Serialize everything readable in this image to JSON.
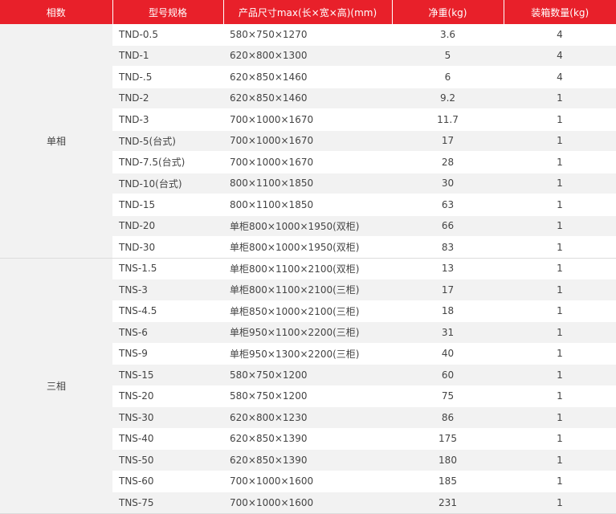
{
  "headers": [
    "相数",
    "型号规格",
    "产品尺寸max(长×宽×高)(mm)",
    "净重(kg)",
    "装箱数量(kg)"
  ],
  "groups": [
    {
      "phase": "单相",
      "rows": [
        {
          "model": "TND-0.5",
          "dims": "580×750×1270",
          "weight": "3.6",
          "qty": "4"
        },
        {
          "model": "TND-1",
          "dims": "620×800×1300",
          "weight": "5",
          "qty": "4"
        },
        {
          "model": "TND-.5",
          "dims": "620×850×1460",
          "weight": "6",
          "qty": "4"
        },
        {
          "model": "TND-2",
          "dims": "620×850×1460",
          "weight": "9.2",
          "qty": "1"
        },
        {
          "model": "TND-3",
          "dims": "700×1000×1670",
          "weight": "11.7",
          "qty": "1"
        },
        {
          "model": "TND-5(台式)",
          "dims": "700×1000×1670",
          "weight": "17",
          "qty": "1"
        },
        {
          "model": "TND-7.5(台式)",
          "dims": "700×1000×1670",
          "weight": "28",
          "qty": "1"
        },
        {
          "model": "TND-10(台式)",
          "dims": "800×1100×1850",
          "weight": "30",
          "qty": "1"
        },
        {
          "model": "TND-15",
          "dims": "800×1100×1850",
          "weight": "63",
          "qty": "1"
        },
        {
          "model": "TND-20",
          "dims": "单柜800×1000×1950(双柜)",
          "weight": "66",
          "qty": "1"
        },
        {
          "model": "TND-30",
          "dims": "单柜800×1000×1950(双柜)",
          "weight": "83",
          "qty": "1"
        }
      ]
    },
    {
      "phase": "三相",
      "rows": [
        {
          "model": "TNS-1.5",
          "dims": "单柜800×1100×2100(双柜)",
          "weight": "13",
          "qty": "1"
        },
        {
          "model": "TNS-3",
          "dims": "单柜800×1100×2100(三柜)",
          "weight": "17",
          "qty": "1"
        },
        {
          "model": "TNS-4.5",
          "dims": "单柜850×1000×2100(三柜)",
          "weight": "18",
          "qty": "1"
        },
        {
          "model": "TNS-6",
          "dims": "单柜950×1100×2200(三柜)",
          "weight": "31",
          "qty": "1"
        },
        {
          "model": "TNS-9",
          "dims": "单柜950×1300×2200(三柜)",
          "weight": "40",
          "qty": "1"
        },
        {
          "model": "TNS-15",
          "dims": "580×750×1200",
          "weight": "60",
          "qty": "1"
        },
        {
          "model": "TNS-20",
          "dims": "580×750×1200",
          "weight": "75",
          "qty": "1"
        },
        {
          "model": "TNS-30",
          "dims": "620×800×1230",
          "weight": "86",
          "qty": "1"
        },
        {
          "model": "TNS-40",
          "dims": "620×850×1390",
          "weight": "175",
          "qty": "1"
        },
        {
          "model": "TNS-50",
          "dims": "620×850×1390",
          "weight": "180",
          "qty": "1"
        },
        {
          "model": "TNS-60",
          "dims": "700×1000×1600",
          "weight": "185",
          "qty": "1"
        },
        {
          "model": "TNS-75",
          "dims": "700×1000×1600",
          "weight": "231",
          "qty": "1"
        }
      ]
    }
  ]
}
